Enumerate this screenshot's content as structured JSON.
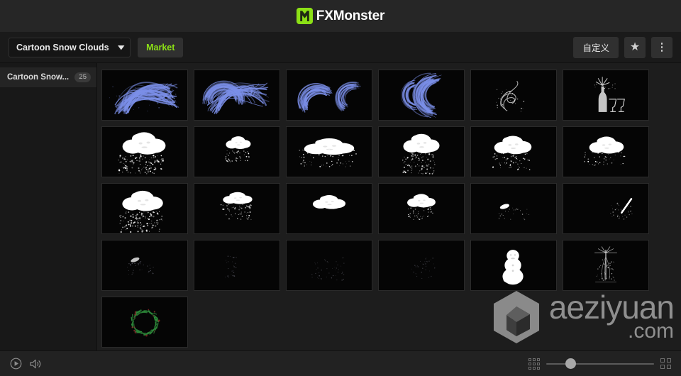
{
  "titlebar": {
    "brand_fx": "FX",
    "brand_monster": "Monster",
    "logo_icon": "monster-m-logo"
  },
  "toolbar": {
    "preset_label": "Cartoon Snow Clouds",
    "chevron_icon": "chevron-down-icon",
    "market_label": "Market",
    "customize_label": "自定义",
    "favorite_icon": "star-icon",
    "more_icon": "more-vertical-icon"
  },
  "sidebar": {
    "items": [
      {
        "label": "Cartoon Snow...",
        "badge": "25"
      }
    ]
  },
  "grid": {
    "items": [
      {
        "name": "blue-brush-stroke-1",
        "art": "brush1"
      },
      {
        "name": "blue-brush-stroke-2",
        "art": "brush2"
      },
      {
        "name": "blue-brush-stroke-3",
        "art": "brush3"
      },
      {
        "name": "blue-brush-stroke-4",
        "art": "brush4"
      },
      {
        "name": "white-swirl-line",
        "art": "swirl"
      },
      {
        "name": "champagne-bottle-glasses",
        "art": "champagne"
      },
      {
        "name": "snow-cloud-heavy-snowfall",
        "art": "cloud-heavy"
      },
      {
        "name": "snow-cloud-small",
        "art": "cloud-small"
      },
      {
        "name": "snow-cloud-wide-burst",
        "art": "cloud-wide"
      },
      {
        "name": "snow-cloud-medium-snowfall",
        "art": "cloud-medium"
      },
      {
        "name": "snow-cloud-light-snowfall",
        "art": "cloud-light"
      },
      {
        "name": "snow-cloud-drifting",
        "art": "cloud-drift"
      },
      {
        "name": "snow-cloud-dense-flakes",
        "art": "cloud-dense"
      },
      {
        "name": "snow-cloud-peak",
        "art": "cloud-peak"
      },
      {
        "name": "snow-cloud-blue-tint",
        "art": "cloud-blue"
      },
      {
        "name": "snow-cloud-puff",
        "art": "cloud-puff"
      },
      {
        "name": "snow-streak-small",
        "art": "streak"
      },
      {
        "name": "snow-sparkle-diagonal",
        "art": "diagonal"
      },
      {
        "name": "faint-snow-wisp",
        "art": "faint-wisp"
      },
      {
        "name": "faint-snow-drip",
        "art": "faint-drip"
      },
      {
        "name": "faint-snow-specks",
        "art": "faint-specks"
      },
      {
        "name": "faint-snow-trail",
        "art": "faint-trail"
      },
      {
        "name": "snowman-figure",
        "art": "snowman"
      },
      {
        "name": "sparkle-burst-firework",
        "art": "firework"
      },
      {
        "name": "green-christmas-wreath",
        "art": "wreath"
      }
    ]
  },
  "watermark": {
    "main": "aeziyuan",
    "sub": ".com",
    "logo_icon": "hexagon-cube-icon"
  },
  "statusbar": {
    "play_icon": "play-circle-icon",
    "volume_icon": "speaker-icon",
    "small_grid_icon": "grid-small-icon",
    "large_grid_icon": "grid-large-icon",
    "zoom_slider": "thumbnail-size-slider",
    "zoom_value": 18
  },
  "colors": {
    "accent_green": "#8ce016",
    "brush_blue": "#7b8fe8",
    "snow_white": "#ffffff",
    "wreath_green": "#2f8f3c",
    "panel_bg": "#1d1d1d",
    "titlebar_bg": "#262626"
  }
}
